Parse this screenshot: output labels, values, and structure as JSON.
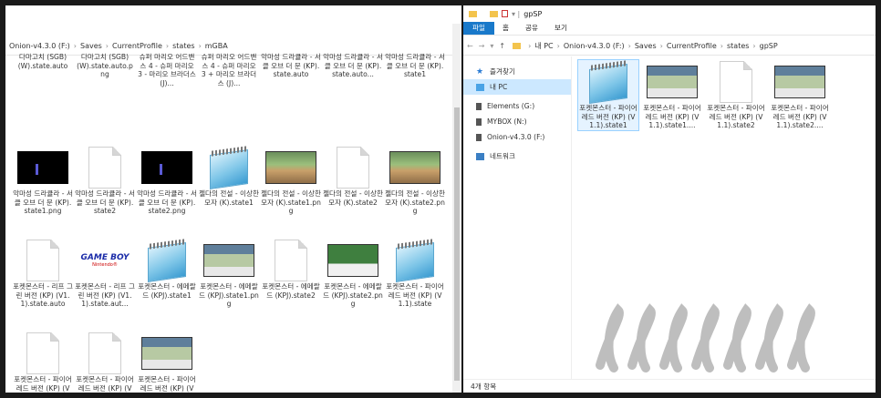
{
  "left": {
    "path": [
      "Onion-v4.3.0 (F:)",
      "Saves",
      "CurrentProfile",
      "states",
      "mGBA"
    ],
    "items": [
      {
        "kind": "cut",
        "label": "다마고치 (SGB) (W).state.auto"
      },
      {
        "kind": "cut",
        "label": "다마고치 (SGB) (W).state.auto.png"
      },
      {
        "kind": "cut",
        "label": "슈퍼 마리오 어드밴스 4 - 슈퍼 마리오 3 - 마리오 브라더스 (J)..."
      },
      {
        "kind": "cut",
        "label": "슈퍼 마리오 어드밴스 4 - 슈퍼 마리오 3 + 마리오 브라더스 (J)..."
      },
      {
        "kind": "cut",
        "label": "악마성 드라큘라 - 서클 오브 더 문 (KP).state.auto"
      },
      {
        "kind": "cut",
        "label": "악마성 드라큘라 - 서클 오브 더 문 (KP).state.auto..."
      },
      {
        "kind": "cut",
        "label": "악마성 드라큘라 - 서클 오브 더 문 (KP).state1"
      },
      {
        "kind": "blackshot",
        "label": "악마성 드라큘라 - 서클 오브 더 문 (KP).state1.png"
      },
      {
        "kind": "doc",
        "label": "악마성 드라큘라 - 서클 오브 더 문 (KP).state2"
      },
      {
        "kind": "blackshot",
        "label": "악마성 드라큘라 - 서클 오브 더 문 (KP).state2.png"
      },
      {
        "kind": "note",
        "label": "젤다의 전설 - 이상한 모자 (K).state1"
      },
      {
        "kind": "gameshot",
        "label": "젤다의 전설 - 이상한 모자 (K).state1.png"
      },
      {
        "kind": "doc",
        "label": "젤다의 전설 - 이상한 모자 (K).state2"
      },
      {
        "kind": "gameshot",
        "label": "젤다의 전설 - 이상한 모자 (K).state2.png"
      },
      {
        "kind": "doc",
        "label": "포켓몬스터 - 리프 그린 버전 (KP) (V1.1).state.auto"
      },
      {
        "kind": "gb",
        "label": "포켓몬스터 - 리프 그린 버전 (KP) (V1.1).state.aut..."
      },
      {
        "kind": "note",
        "label": "포켓몬스터 - 에메랄드 (KPJ).state1"
      },
      {
        "kind": "townshot",
        "label": "포켓몬스터 - 에메랄드 (KPJ).state1.png"
      },
      {
        "kind": "doc",
        "label": "포켓몬스터 - 에메랄드 (KPJ).state2"
      },
      {
        "kind": "greenshot",
        "label": "포켓몬스터 - 에메랄드 (KPJ).state2.png"
      },
      {
        "kind": "note",
        "label": "포켓몬스터 - 파이어 레드 버전 (KP) (V1.1).state"
      },
      {
        "kind": "doc",
        "label": "포켓몬스터 - 파이어 레드 버전 (KP) (V1.1).state.auto"
      },
      {
        "kind": "blank",
        "label": "포켓몬스터 - 파이어 레드 버전 (KP) (V1.1).state.aut..."
      },
      {
        "kind": "townshot",
        "label": "포켓몬스터 - 파이어 레드 버전 (KP) (V1.1).state.png"
      }
    ],
    "gb_title": "GAME BOY",
    "gb_sub": "Nintendo®"
  },
  "right": {
    "title": "gpSP",
    "ribbon": [
      "파일",
      "홈",
      "공유",
      "보기"
    ],
    "path": [
      "내 PC",
      "Onion-v4.3.0 (F:)",
      "Saves",
      "CurrentProfile",
      "states",
      "gpSP"
    ],
    "nav": [
      {
        "icon": "star-icon",
        "label": "즐겨찾기"
      },
      {
        "icon": "pc-icon",
        "label": "내 PC",
        "selected": true
      },
      {
        "icon": "drive-icon",
        "label": "Elements (G:)"
      },
      {
        "icon": "drive-icon",
        "label": "MYBOX (N:)"
      },
      {
        "icon": "drive-icon",
        "label": "Onion-v4.3.0 (F:)"
      },
      {
        "icon": "network-icon",
        "label": "네트워크"
      }
    ],
    "items": [
      {
        "kind": "note",
        "label": "포켓몬스터 - 파이어 레드 버전 (KP) (V1.1).state1",
        "selected": true
      },
      {
        "kind": "townshot",
        "label": "포켓몬스터 - 파이어 레드 버전 (KP) (V1.1).state1...."
      },
      {
        "kind": "doc",
        "label": "포켓몬스터 - 파이어 레드 버전 (KP) (V1.1).state2"
      },
      {
        "kind": "townshot",
        "label": "포켓몬스터 - 파이어 레드 버전 (KP) (V1.1).state2...."
      }
    ],
    "status": "4개 항목"
  },
  "watermark": "LLLLLLL"
}
